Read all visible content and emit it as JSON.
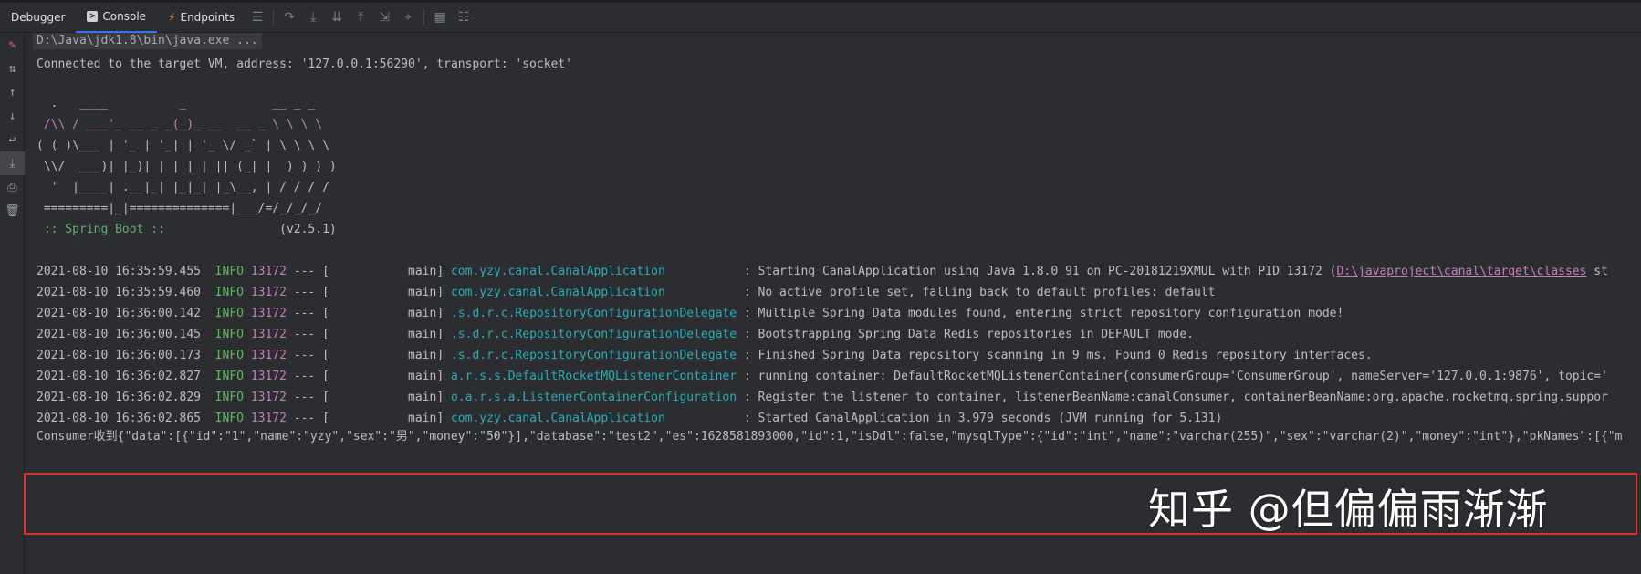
{
  "toolbar": {
    "tabs": [
      {
        "label": "Debugger"
      },
      {
        "label": "Console"
      },
      {
        "label": "Endpoints"
      }
    ],
    "icons": [
      "menu-icon",
      "step-over-icon",
      "step-into-icon",
      "force-step-into-icon",
      "step-out-icon",
      "run-to-cursor-icon",
      "evaluate-icon",
      "table-icon",
      "settings-icon"
    ]
  },
  "sidebar": {
    "icons": [
      "clear-icon",
      "scroll-to-end-icon",
      "up-icon",
      "down-icon",
      "soft-wrap-icon",
      "scroll-icon",
      "print-icon",
      "trash-icon"
    ]
  },
  "console": {
    "cmd": "D:\\Java\\jdk1.8\\bin\\java.exe ...",
    "connected": "Connected to the target VM, address: '127.0.0.1:56290', transport: 'socket'",
    "banner": [
      "  .   ____          _            __ _ _",
      " /\\\\ / ___'_ __ _ _(_)_ __  __ _ \\ \\ \\ \\",
      "( ( )\\___ | '_ | '_| | '_ \\/ _` | \\ \\ \\ \\",
      " \\\\/  ___)| |_)| | | | | || (_| |  ) ) ) )",
      "  '  |____| .__|_| |_|_| |_\\__, | / / / /",
      " =========|_|==============|___/=/_/_/_/"
    ],
    "spring_label": " :: Spring Boot ::",
    "spring_version": "(v2.5.1)",
    "logs": [
      {
        "ts": "2021-08-10 16:35:59.455",
        "level": "INFO",
        "pid": "13172",
        "sep": "--- [",
        "thread": "main]",
        "logger": "com.yzy.canal.CanalApplication",
        "msg": ": Starting CanalApplication using Java 1.8.0_91 on PC-20181219XMUL with PID 13172 (",
        "link": "D:\\javaproject\\canal\\target\\classes",
        "tail": " st"
      },
      {
        "ts": "2021-08-10 16:35:59.460",
        "level": "INFO",
        "pid": "13172",
        "sep": "--- [",
        "thread": "main]",
        "logger": "com.yzy.canal.CanalApplication",
        "msg": ": No active profile set, falling back to default profiles: default"
      },
      {
        "ts": "2021-08-10 16:36:00.142",
        "level": "INFO",
        "pid": "13172",
        "sep": "--- [",
        "thread": "main]",
        "logger": ".s.d.r.c.RepositoryConfigurationDelegate",
        "msg": ": Multiple Spring Data modules found, entering strict repository configuration mode!"
      },
      {
        "ts": "2021-08-10 16:36:00.145",
        "level": "INFO",
        "pid": "13172",
        "sep": "--- [",
        "thread": "main]",
        "logger": ".s.d.r.c.RepositoryConfigurationDelegate",
        "msg": ": Bootstrapping Spring Data Redis repositories in DEFAULT mode."
      },
      {
        "ts": "2021-08-10 16:36:00.173",
        "level": "INFO",
        "pid": "13172",
        "sep": "--- [",
        "thread": "main]",
        "logger": ".s.d.r.c.RepositoryConfigurationDelegate",
        "msg": ": Finished Spring Data repository scanning in 9 ms. Found 0 Redis repository interfaces."
      },
      {
        "ts": "2021-08-10 16:36:02.827",
        "level": "INFO",
        "pid": "13172",
        "sep": "--- [",
        "thread": "main]",
        "logger": "a.r.s.s.DefaultRocketMQListenerContainer",
        "msg": ": running container: DefaultRocketMQListenerContainer{consumerGroup='ConsumerGroup', nameServer='127.0.0.1:9876', topic='"
      },
      {
        "ts": "2021-08-10 16:36:02.829",
        "level": "INFO",
        "pid": "13172",
        "sep": "--- [",
        "thread": "main]",
        "logger": "o.a.r.s.a.ListenerContainerConfiguration",
        "msg": ": Register the listener to container, listenerBeanName:canalConsumer, containerBeanName:org.apache.rocketmq.spring.suppor"
      },
      {
        "ts": "2021-08-10 16:36:02.865",
        "level": "INFO",
        "pid": "13172",
        "sep": "--- [",
        "thread": "main]",
        "logger": "com.yzy.canal.CanalApplication",
        "msg": ": Started CanalApplication in 3.979 seconds (JVM running for 5.131)"
      }
    ],
    "consumer": "Consumer收到{\"data\":[{\"id\":\"1\",\"name\":\"yzy\",\"sex\":\"男\",\"money\":\"50\"}],\"database\":\"test2\",\"es\":1628581893000,\"id\":1,\"isDdl\":false,\"mysqlType\":{\"id\":\"int\",\"name\":\"varchar(255)\",\"sex\":\"varchar(2)\",\"money\":\"int\"},\"pkNames\":[{\"m"
  },
  "watermark": "知乎 @但偏偏雨渐渐",
  "colors": {
    "accent": "#3574f0",
    "highlight": "#e0302b"
  }
}
